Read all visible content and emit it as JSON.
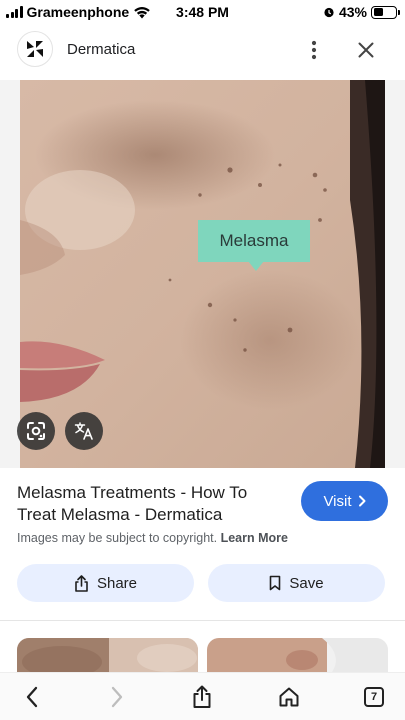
{
  "status_bar": {
    "carrier": "Grameenphone",
    "time": "3:48 PM",
    "battery": "43%",
    "battery_level": 0.43
  },
  "header": {
    "site_name": "Dermatica",
    "icons": [
      "dermatica-logo-icon",
      "more-vert-icon",
      "close-icon"
    ]
  },
  "image": {
    "tag_label": "Melasma",
    "icons": [
      "google-lens-icon",
      "translate-icon"
    ]
  },
  "result": {
    "title": "Melasma Treatments - How To Treat Melasma - Dermatica",
    "visit_label": "Visit",
    "copyright_text": "Images may be subject to copyright.",
    "learn_more": "Learn More"
  },
  "actions": {
    "share_label": "Share",
    "save_label": "Save"
  },
  "bottom_nav": {
    "tab_count": "7",
    "icons": [
      "back-icon",
      "forward-icon",
      "share-icon",
      "home-icon",
      "tabs-icon"
    ]
  },
  "colors": {
    "accent": "#2f6fde",
    "tag": "#7fd6bd",
    "pill": "#e8efff"
  }
}
